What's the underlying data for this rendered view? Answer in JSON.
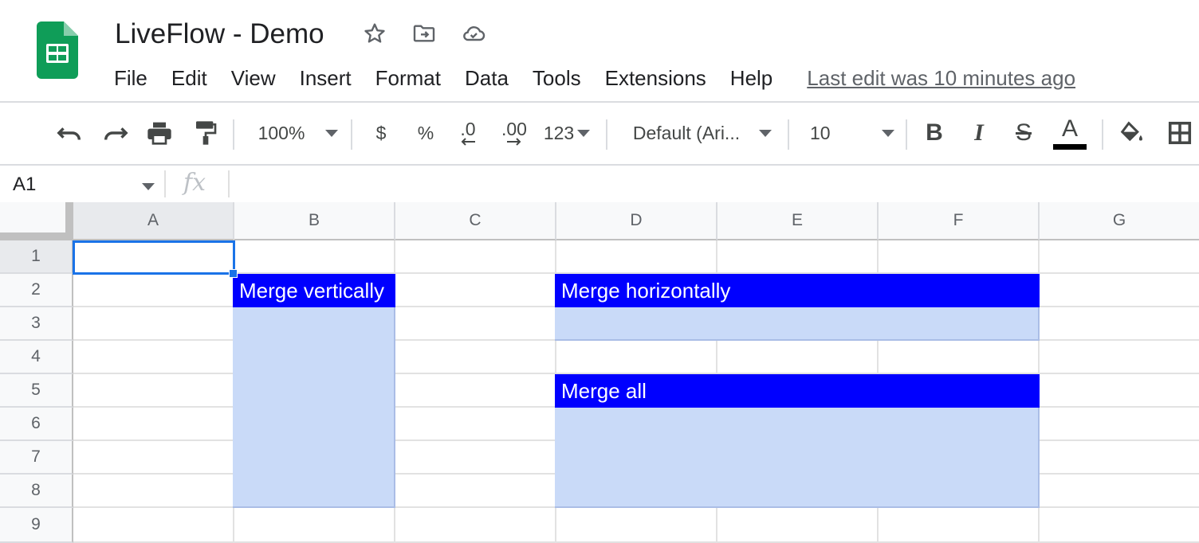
{
  "app": {
    "doc_title": "LiveFlow - Demo",
    "icons": [
      "star-icon",
      "move-to-folder-icon",
      "cloud-saved-icon"
    ],
    "brand_color": "#0f9d58"
  },
  "menu": {
    "items": [
      "File",
      "Edit",
      "View",
      "Insert",
      "Format",
      "Data",
      "Tools",
      "Extensions",
      "Help"
    ],
    "last_edit": "Last edit was 10 minutes ago"
  },
  "toolbar": {
    "zoom": "100%",
    "currency": "$",
    "percent": "%",
    "decrease_decimal": ".0",
    "increase_decimal": ".00",
    "more_formats": "123",
    "font": "Default (Ari...",
    "font_size": "10",
    "bold": "B",
    "italic": "I",
    "strikethrough": "S",
    "text_color": "A"
  },
  "formula_bar": {
    "name_box": "A1",
    "fx": "fx"
  },
  "sheet": {
    "columns": [
      "A",
      "B",
      "C",
      "D",
      "E",
      "F",
      "G"
    ],
    "rows": [
      "1",
      "2",
      "3",
      "4",
      "5",
      "6",
      "7",
      "8",
      "9"
    ],
    "selected_cell": "A1",
    "merges": {
      "vertical": {
        "label": "Merge vertically",
        "range": "B2:B8"
      },
      "horizontal": {
        "label": "Merge horizontally",
        "range": "D2:F3"
      },
      "all": {
        "label": "Merge all",
        "range": "D5:F8"
      }
    },
    "colors": {
      "header_fill": "#0000ff",
      "body_fill": "#c9daf8",
      "selection": "#1a73e8"
    }
  }
}
